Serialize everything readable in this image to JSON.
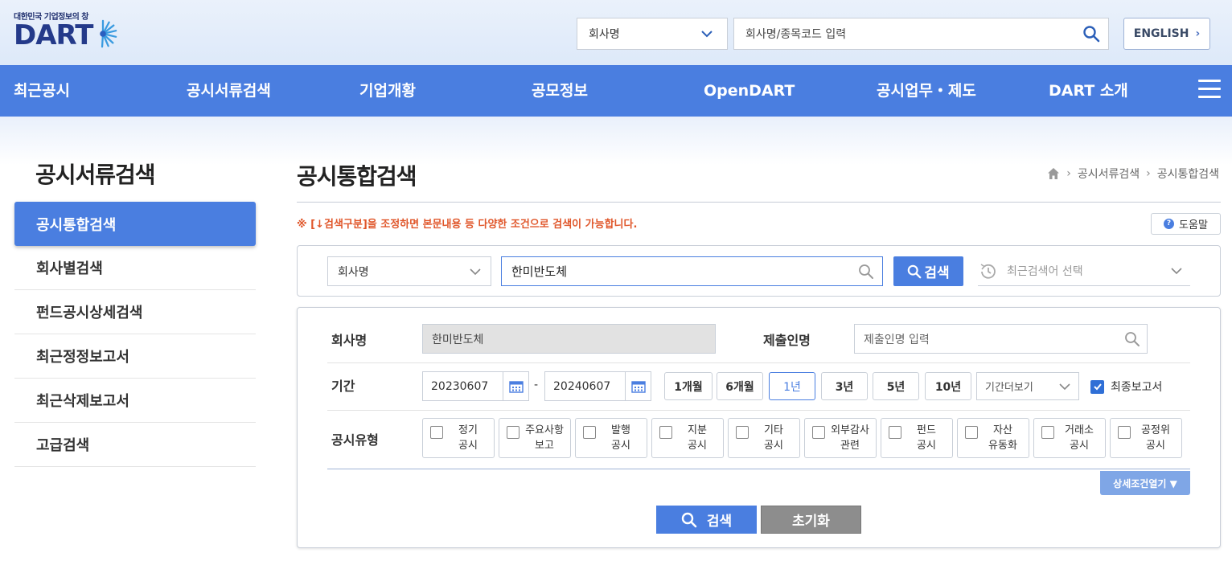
{
  "header": {
    "logo_tagline": "대한민국 기업정보의 창",
    "logo_text": "DART",
    "scope_select": "회사명",
    "search_placeholder": "회사명/종목코드 입력",
    "english_label": "ENGLISH"
  },
  "gnb": {
    "items": [
      "최근공시",
      "공시서류검색",
      "기업개황",
      "공모정보",
      "OpenDART",
      "공시업무・제도",
      "DART 소개"
    ]
  },
  "sidebar": {
    "title": "공시서류검색",
    "items": [
      "공시통합검색",
      "회사별검색",
      "펀드공시상세검색",
      "최근정정보고서",
      "최근삭제보고서",
      "고급검색"
    ],
    "active_index": 0
  },
  "content": {
    "title": "공시통합검색",
    "breadcrumb": [
      "공시서류검색",
      "공시통합검색"
    ],
    "notice": "※ [↓검색구분]을 조정하면 본문내용 등 다양한 조건으로 검색이 가능합니다.",
    "help_label": "도움말"
  },
  "search_box": {
    "category": "회사명",
    "query": "한미반도체",
    "search_label": "검색",
    "recent_placeholder": "최근검색어 선택"
  },
  "detail": {
    "company_label": "회사명",
    "company_value": "한미반도체",
    "submitter_label": "제출인명",
    "submitter_placeholder": "제출인명 입력",
    "period_label": "기간",
    "start_date": "20230607",
    "end_date": "20240607",
    "date_separator": "-",
    "periods": [
      "1개월",
      "6개월",
      "1년",
      "3년",
      "5년",
      "10년"
    ],
    "selected_period": "1년",
    "period_more": "기간더보기",
    "final_report_label": "최종보고서",
    "final_report_checked": true,
    "type_label": "공시유형",
    "types": [
      {
        "line1": "정기",
        "line2": "공시"
      },
      {
        "line1": "주요사항",
        "line2": "보고"
      },
      {
        "line1": "발행",
        "line2": "공시"
      },
      {
        "line1": "지분",
        "line2": "공시"
      },
      {
        "line1": "기타",
        "line2": "공시"
      },
      {
        "line1": "외부감사",
        "line2": "관련"
      },
      {
        "line1": "펀드",
        "line2": "공시"
      },
      {
        "line1": "자산",
        "line2": "유동화"
      },
      {
        "line1": "거래소",
        "line2": "공시"
      },
      {
        "line1": "공정위",
        "line2": "공시"
      }
    ],
    "more_conditions_label": "상세조건열기 ▼",
    "search_button": "검색",
    "reset_button": "초기화"
  },
  "colors": {
    "primary": "#4a7ee0",
    "notice": "#e0572b",
    "reset": "#8d8d8d"
  }
}
